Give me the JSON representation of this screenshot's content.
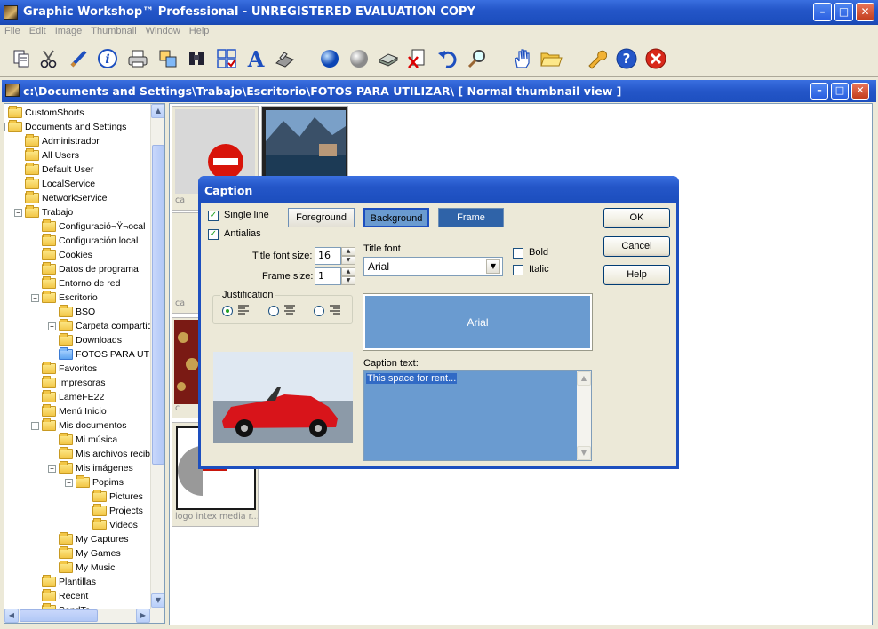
{
  "app": {
    "title": "Graphic Workshop™ Professional - UNREGISTERED EVALUATION COPY"
  },
  "menu": [
    "File",
    "Edit",
    "Image",
    "Thumbnail",
    "Window",
    "Help"
  ],
  "toolbar_icons": [
    "copy-icon",
    "cut-icon",
    "brush-icon",
    "info-icon",
    "print-icon",
    "duplicate-icon",
    "binoculars-icon",
    "select-icon",
    "text-icon",
    "scanner-icon",
    "blue-ball-icon",
    "grey-ball-icon",
    "disk-icon",
    "delete-doc-icon",
    "undo-icon",
    "magnifier-icon",
    "hand-icon",
    "folder-icon",
    "wrench-icon",
    "help-icon",
    "close-icon"
  ],
  "window": {
    "title": "c:\\Documents and Settings\\Trabajo\\Escritorio\\FOTOS PARA UTILIZAR\\ [ Normal thumbnail view ]"
  },
  "tree": [
    {
      "label": "CustomShorts",
      "depth": 0,
      "pm": ""
    },
    {
      "label": "Documents and Settings",
      "depth": 0,
      "pm": "-"
    },
    {
      "label": "Administrador",
      "depth": 1,
      "pm": ""
    },
    {
      "label": "All Users",
      "depth": 1,
      "pm": ""
    },
    {
      "label": "Default User",
      "depth": 1,
      "pm": ""
    },
    {
      "label": "LocalService",
      "depth": 1,
      "pm": ""
    },
    {
      "label": "NetworkService",
      "depth": 1,
      "pm": ""
    },
    {
      "label": "Trabajo",
      "depth": 1,
      "pm": "-"
    },
    {
      "label": "Configuració¬Ÿ¬ocal",
      "depth": 2,
      "pm": ""
    },
    {
      "label": "Configuración local",
      "depth": 2,
      "pm": ""
    },
    {
      "label": "Cookies",
      "depth": 2,
      "pm": ""
    },
    {
      "label": "Datos de programa",
      "depth": 2,
      "pm": ""
    },
    {
      "label": "Entorno de red",
      "depth": 2,
      "pm": ""
    },
    {
      "label": "Escritorio",
      "depth": 2,
      "pm": "-"
    },
    {
      "label": "BSO",
      "depth": 3,
      "pm": ""
    },
    {
      "label": "Carpeta compartida",
      "depth": 3,
      "pm": "+"
    },
    {
      "label": "Downloads",
      "depth": 3,
      "pm": ""
    },
    {
      "label": "FOTOS PARA UTILIZAR",
      "depth": 3,
      "pm": "",
      "open": true
    },
    {
      "label": "Favoritos",
      "depth": 2,
      "pm": ""
    },
    {
      "label": "Impresoras",
      "depth": 2,
      "pm": ""
    },
    {
      "label": "LameFE22",
      "depth": 2,
      "pm": ""
    },
    {
      "label": "Menú Inicio",
      "depth": 2,
      "pm": ""
    },
    {
      "label": "Mis documentos",
      "depth": 2,
      "pm": "-"
    },
    {
      "label": "Mi música",
      "depth": 3,
      "pm": ""
    },
    {
      "label": "Mis archivos recibidos",
      "depth": 3,
      "pm": ""
    },
    {
      "label": "Mis imágenes",
      "depth": 3,
      "pm": "-"
    },
    {
      "label": "Popims",
      "depth": 4,
      "pm": "-"
    },
    {
      "label": "Pictures",
      "depth": 5,
      "pm": ""
    },
    {
      "label": "Projects",
      "depth": 5,
      "pm": ""
    },
    {
      "label": "Videos",
      "depth": 5,
      "pm": ""
    },
    {
      "label": "My Captures",
      "depth": 3,
      "pm": ""
    },
    {
      "label": "My Games",
      "depth": 3,
      "pm": ""
    },
    {
      "label": "My Music",
      "depth": 3,
      "pm": ""
    },
    {
      "label": "Plantillas",
      "depth": 2,
      "pm": ""
    },
    {
      "label": "Recent",
      "depth": 2,
      "pm": ""
    },
    {
      "label": "SendTo",
      "depth": 2,
      "pm": ""
    }
  ],
  "thumbs": [
    {
      "label": "ca"
    },
    {
      "label": ""
    },
    {
      "label": "ca"
    },
    {
      "label": "c"
    },
    {
      "label": "logo intex media r..."
    }
  ],
  "dialog": {
    "title": "Caption",
    "single_line": "Single line",
    "antialias": "Antialias",
    "single_line_checked": true,
    "antialias_checked": true,
    "foreground": "Foreground",
    "background": "Background",
    "frame": "Frame",
    "ok": "OK",
    "cancel": "Cancel",
    "help": "Help",
    "title_font_size_label": "Title font size:",
    "title_font_size": "16",
    "frame_size_label": "Frame size:",
    "frame_size": "1",
    "title_font_label": "Title font",
    "title_font": "Arial",
    "bold": "Bold",
    "italic": "Italic",
    "bold_checked": false,
    "italic_checked": false,
    "justification": "Justification",
    "justification_selected": "left",
    "preview_text": "Arial",
    "caption_text_label": "Caption text:",
    "caption_text": "This space for rent...",
    "colors": {
      "background_swatch": "#6a9bd0",
      "frame_swatch": "#2f63a8",
      "preview": "#6a9bd0",
      "caption_bg": "#6a9bd0"
    }
  }
}
